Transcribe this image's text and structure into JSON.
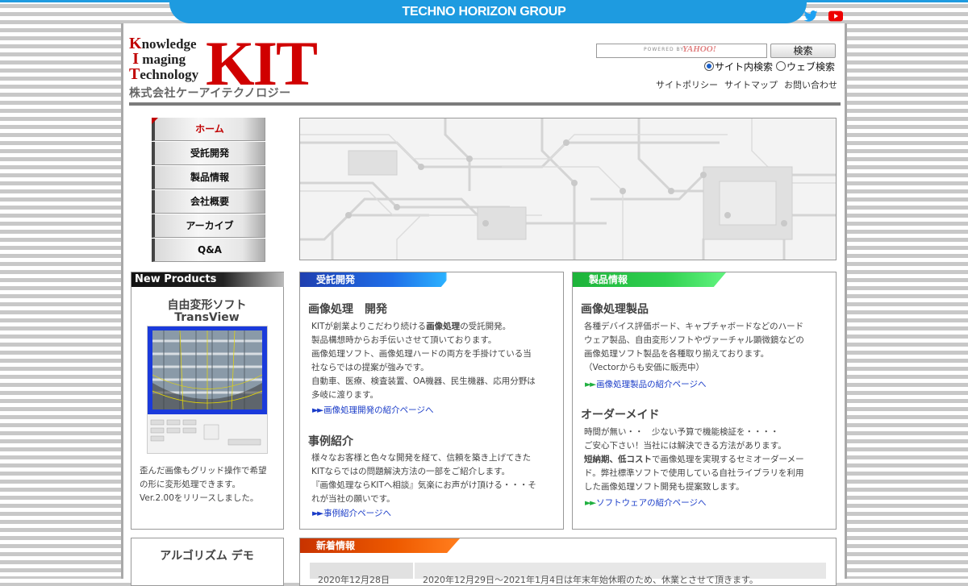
{
  "topbar": {
    "group_title": "TECHNO HORIZON GROUP",
    "social": [
      "twitter-icon",
      "youtube-icon"
    ],
    "accent": "#1e9be0"
  },
  "logo": {
    "line1_cap": "K",
    "line1_rest": "nowledge",
    "line2_cap": "I",
    "line2_rest": "maging",
    "line3_cap": "T",
    "line3_rest": "echnology",
    "mark": "KIT",
    "company": "株式会社ケーアイテクノロジー"
  },
  "search": {
    "powered_by": "POWERED BY",
    "provider": "YAHOO!",
    "button": "検索",
    "radio_site": "サイト内検索",
    "radio_web": "ウェブ検索"
  },
  "utility_links": [
    "サイトポリシー",
    "サイトマップ",
    "お問い合わせ"
  ],
  "nav": [
    "ホーム",
    "受託開発",
    "製品情報",
    "会社概要",
    "アーカイブ",
    "Q&A"
  ],
  "new_products": {
    "heading": "New Products",
    "title_line1": "自由変形ソフト",
    "title_line2": "TransView",
    "desc": [
      "歪んだ画像もグリッド操作で希望",
      "の形に変形処理できます。",
      "Ver.2.00をリリースしました。"
    ]
  },
  "algorithm_demo": {
    "heading": "アルゴリズム デモ"
  },
  "contract_dev": {
    "heading": "受託開発",
    "section1_title": "画像処理　開発",
    "section1_lines": [
      "KITが創業よりこだわり続ける",
      "画像処理",
      "の受託開発。",
      "製品構想時からお手伝いさせて頂いております。",
      "画像処理ソフト、画像処理ハードの両方を手掛けている当",
      "社ならではの提案が強みです。",
      "自動車、医療、検査装置、OA機器、民生機器、応用分野は",
      "多岐に渡ります。"
    ],
    "section1_link": "画像処理開発の紹介ページへ",
    "section2_title": "事例紹介",
    "section2_lines": [
      "様々なお客様と色々な開発を経て、信頼を築き上げてきた",
      "KITならではの問題解決方法の一部をご紹介します。",
      "『画像処理ならKITへ相談』気楽にお声がけ頂ける・・・そ",
      "れが当社の願いです。"
    ],
    "section2_link": "事例紹介ページへ"
  },
  "product_info": {
    "heading": "製品情報",
    "section1_title": "画像処理製品",
    "section1_lines": [
      "各種デバイス評価ボード、キャプチャボードなどのハード",
      "ウェア製品、自由変形ソフトやヴァーチャル顕微鏡などの",
      "画像処理ソフト製品を各種取り揃えております。",
      "（Vectorからも安価に販売中）"
    ],
    "section1_link": "画像処理製品の紹介ページへ",
    "section2_title": "オーダーメイド",
    "section2_lines": [
      "時間が無い・・　少ない予算で機能検証を・・・・",
      "ご安心下さい！当社には解決できる方法があります。",
      "短納期、低コスト",
      "で画像処理を実現するセミオーダーメー",
      "ド。弊社標準ソフトで使用している自社ライブラリを利用",
      "した画像処理ソフト開発も提案致します。"
    ],
    "section2_link": "ソフトウェアの紹介ページへ"
  },
  "news": {
    "heading": "新着情報",
    "rows": [
      {
        "date": "2020年12月28日",
        "text": "2020年12月29日～2021年1月4日は年末年始休暇のため、休業とさせて頂きます。"
      }
    ]
  }
}
